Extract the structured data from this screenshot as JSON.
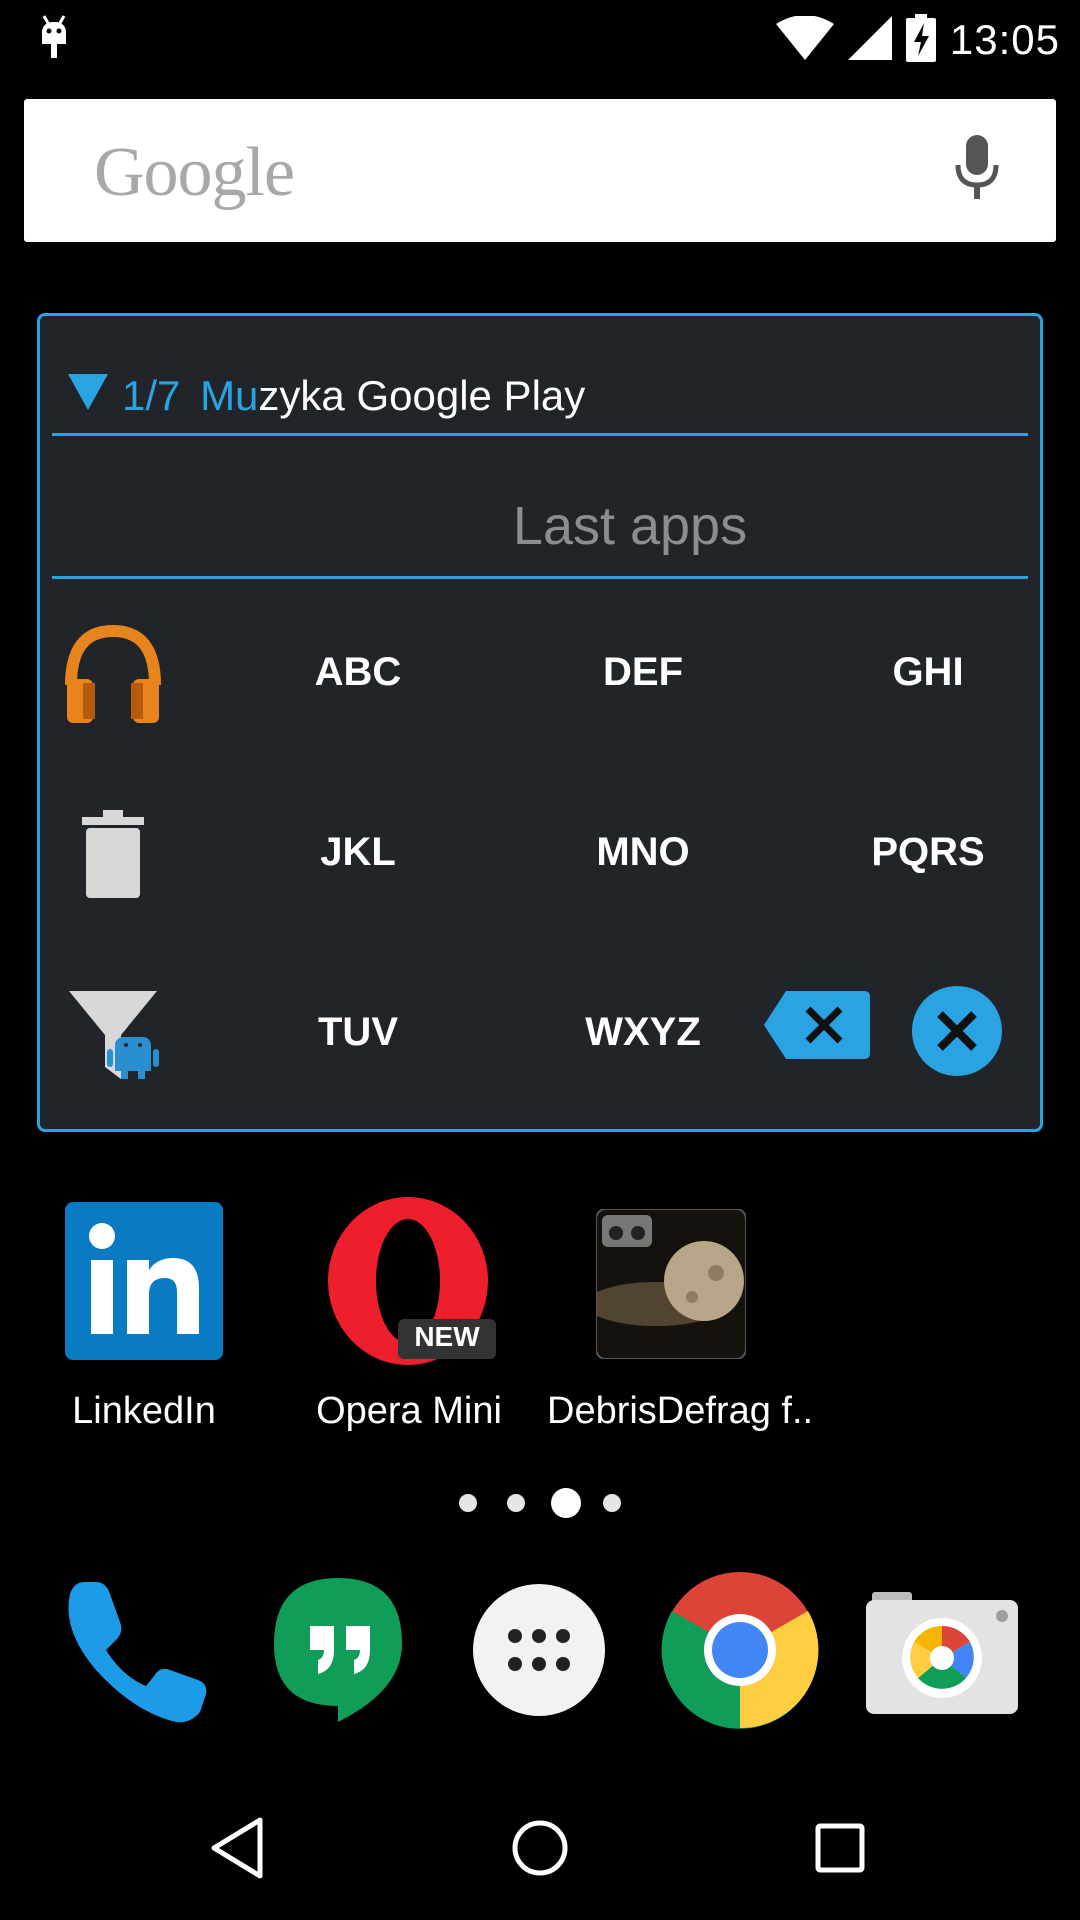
{
  "status_bar": {
    "time": "13:05",
    "icons": [
      "android-debug-icon",
      "wifi-icon",
      "cell-signal-icon",
      "battery-charging-icon"
    ]
  },
  "search": {
    "logo": "Google",
    "mic_icon": "mic-icon"
  },
  "widget": {
    "header_prefix": "1/7",
    "header_match": "Mu",
    "header_rest": "zyka Google Play",
    "last_apps_label": "Last apps",
    "keys": [
      [
        "ABC",
        "DEF",
        "GHI"
      ],
      [
        "JKL",
        "MNO",
        "PQRS"
      ],
      [
        "TUV",
        "WXYZ"
      ]
    ],
    "left_icons": [
      "google-play-music-icon",
      "trash-icon",
      "android-filter-icon"
    ],
    "accent_color": "#2aa3e3"
  },
  "apps": [
    {
      "label": "LinkedIn",
      "icon": "linkedin-icon"
    },
    {
      "label": "Opera Mini",
      "icon": "opera-mini-icon",
      "badge": "NEW"
    },
    {
      "label": "DebrisDefrag f..",
      "icon": "debrisdefrag-icon"
    }
  ],
  "page_indicator": {
    "pages": 4,
    "current": 3
  },
  "dock": [
    "phone-icon",
    "hangouts-icon",
    "app-drawer-icon",
    "chrome-icon",
    "camera-icon"
  ],
  "nav": [
    "back-button",
    "home-button",
    "recents-button"
  ]
}
